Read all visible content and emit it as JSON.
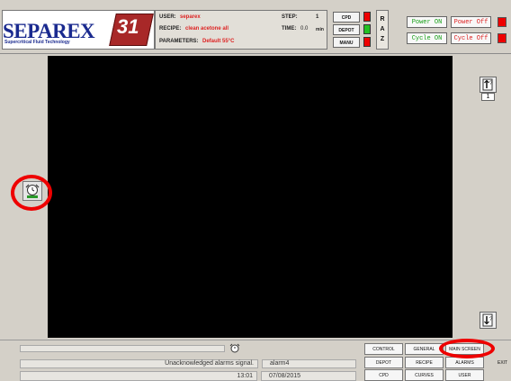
{
  "header": {
    "logo_text": "SEPAREX",
    "logo_tagline": "Supercritical Fluid Technology",
    "logo_badge": "31",
    "user_label": "USER:",
    "user_value": "separex",
    "recipe_label": "RECIPE:",
    "recipe_value": "clean acetone all",
    "parameters_label": "PARAMETERS:",
    "parameters_value": "Default 55°C",
    "step_label": "STEP:",
    "step_value": "1",
    "time_label": "TIME:",
    "time_value": "0.0",
    "time_unit": "min",
    "modes": [
      {
        "label": "CPD",
        "led": "red"
      },
      {
        "label": "DEPOT",
        "led": "green"
      },
      {
        "label": "MANU",
        "led": "red"
      }
    ],
    "raz_letters": [
      "R",
      "A",
      "Z"
    ],
    "power_on_label": "Power ON",
    "power_off_label": "Power Off",
    "cycle_on_label": "Cycle ON",
    "cycle_off_label": "Cycle Off"
  },
  "side": {
    "page_number": "1"
  },
  "footer": {
    "alarm_message": "Unacknowledged alarms signal.",
    "alarm_name": "alarm4",
    "time": "13:01",
    "date": "07/08/2015",
    "nav": {
      "row1": [
        "CONTROL",
        "GENERAL",
        "MAIN SCREEN"
      ],
      "row2": [
        "DEPOT",
        "RECIPE",
        "ALARMS"
      ],
      "row3": [
        "CPD",
        "CURVES",
        "USER"
      ],
      "exit": "EXIT"
    }
  },
  "colors": {
    "accent_red": "#e00000",
    "led_green": "#22c022",
    "brand_blue": "#1a2a8f"
  }
}
